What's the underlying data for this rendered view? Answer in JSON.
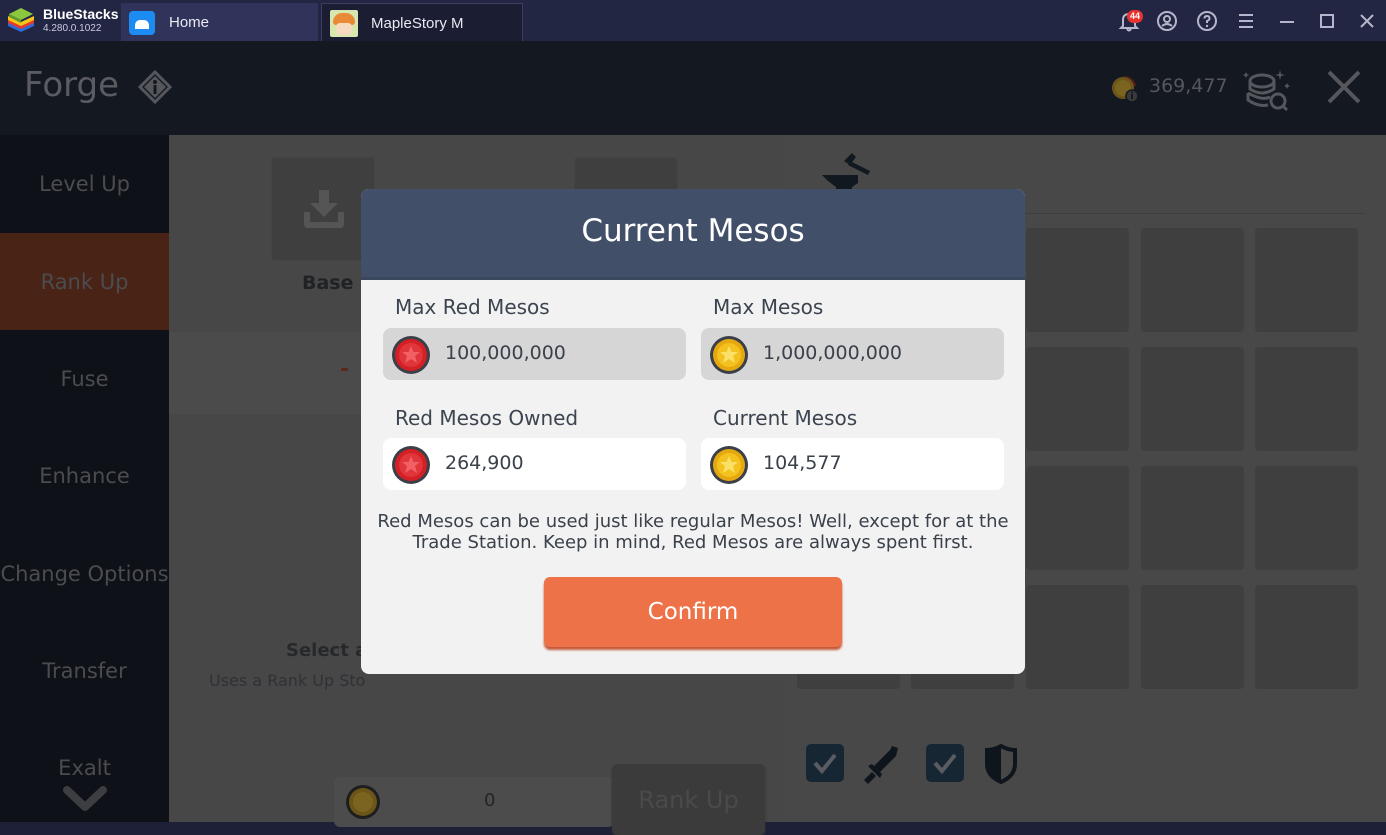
{
  "app": {
    "name": "BlueStacks",
    "version": "4.280.0.1022",
    "tabs": [
      {
        "label": "Home",
        "icon": "home-icon"
      },
      {
        "label": "MapleStory M",
        "icon": "maplestory-app-icon"
      }
    ],
    "notification_count": "44",
    "window_controls": [
      "bell-icon",
      "account-icon",
      "help-icon",
      "menu-icon",
      "minimize-icon",
      "maximize-icon",
      "close-icon"
    ]
  },
  "game": {
    "title": "Forge",
    "mesos_balance": "369,477",
    "sidebar": [
      {
        "label": "Level Up",
        "active": false
      },
      {
        "label": "Rank Up",
        "active": true
      },
      {
        "label": "Fuse",
        "active": false
      },
      {
        "label": "Enhance",
        "active": false
      },
      {
        "label": "Change Options",
        "active": false
      },
      {
        "label": "Transfer",
        "active": false
      },
      {
        "label": "Exalt",
        "active": false
      }
    ],
    "base_slot_label": "Base",
    "placeholder_dash": "-",
    "select_prompt": "Select a",
    "uses_text": "Uses a Rank Up Sto",
    "cost_value": "0",
    "rank_up_button": "Rank Up",
    "filters": [
      {
        "icon": "sword-icon",
        "checked": true
      },
      {
        "icon": "shield-icon",
        "checked": true
      }
    ]
  },
  "modal": {
    "title": "Current Mesos",
    "fields": [
      {
        "label": "Max Red Mesos",
        "value": "100,000,000",
        "coin": "red"
      },
      {
        "label": "Max Mesos",
        "value": "1,000,000,000",
        "coin": "gold"
      },
      {
        "label": "Red Mesos Owned",
        "value": "264,900",
        "coin": "red"
      },
      {
        "label": "Current Mesos",
        "value": "104,577",
        "coin": "gold"
      }
    ],
    "note_line1": "Red Mesos can be used just like regular Mesos! Well, except for at the",
    "note_line2": "Trade Station. Keep in mind, Red Mesos are always spent first.",
    "confirm_label": "Confirm"
  },
  "colors": {
    "accent_orange": "#ee7248",
    "modal_header": "#415068",
    "active_sidebar": "#4a2317"
  }
}
